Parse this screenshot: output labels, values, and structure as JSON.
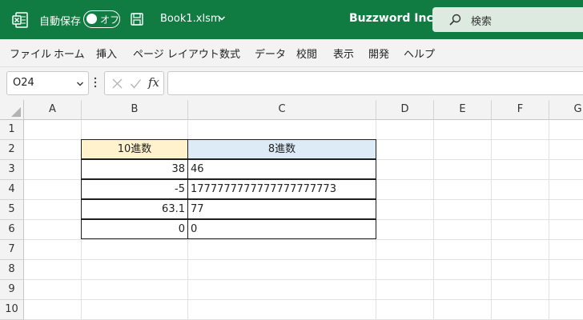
{
  "titlebar": {
    "autosave_label": "自動保存",
    "autosave_state": "オフ",
    "filename": "Book1.xlsm",
    "company": "Buzzword Inc.",
    "search_placeholder": "検索",
    "bg_color": "#107c41"
  },
  "menu": [
    "ファイル",
    "ホーム",
    "挿入",
    "ページ レイアウト",
    "数式",
    "データ",
    "校閲",
    "表示",
    "開発",
    "ヘルプ"
  ],
  "formula_bar": {
    "name_box": "O24",
    "formula": "",
    "fx_label": "fx"
  },
  "columns": [
    "A",
    "B",
    "C",
    "D",
    "E",
    "F",
    "G"
  ],
  "rows": [
    "1",
    "2",
    "3",
    "4",
    "5",
    "6",
    "7",
    "8",
    "9",
    "10"
  ],
  "table": {
    "header_decimal": "10進数",
    "header_octal": "8進数",
    "header_decimal_color": "#fff2cc",
    "header_octal_color": "#ddebf7",
    "rows": [
      {
        "decimal": "38",
        "octal": "46"
      },
      {
        "decimal": "-5",
        "octal": "1777777777777777777773"
      },
      {
        "decimal": "63.1",
        "octal": "77"
      },
      {
        "decimal": "0",
        "octal": "0"
      }
    ]
  }
}
